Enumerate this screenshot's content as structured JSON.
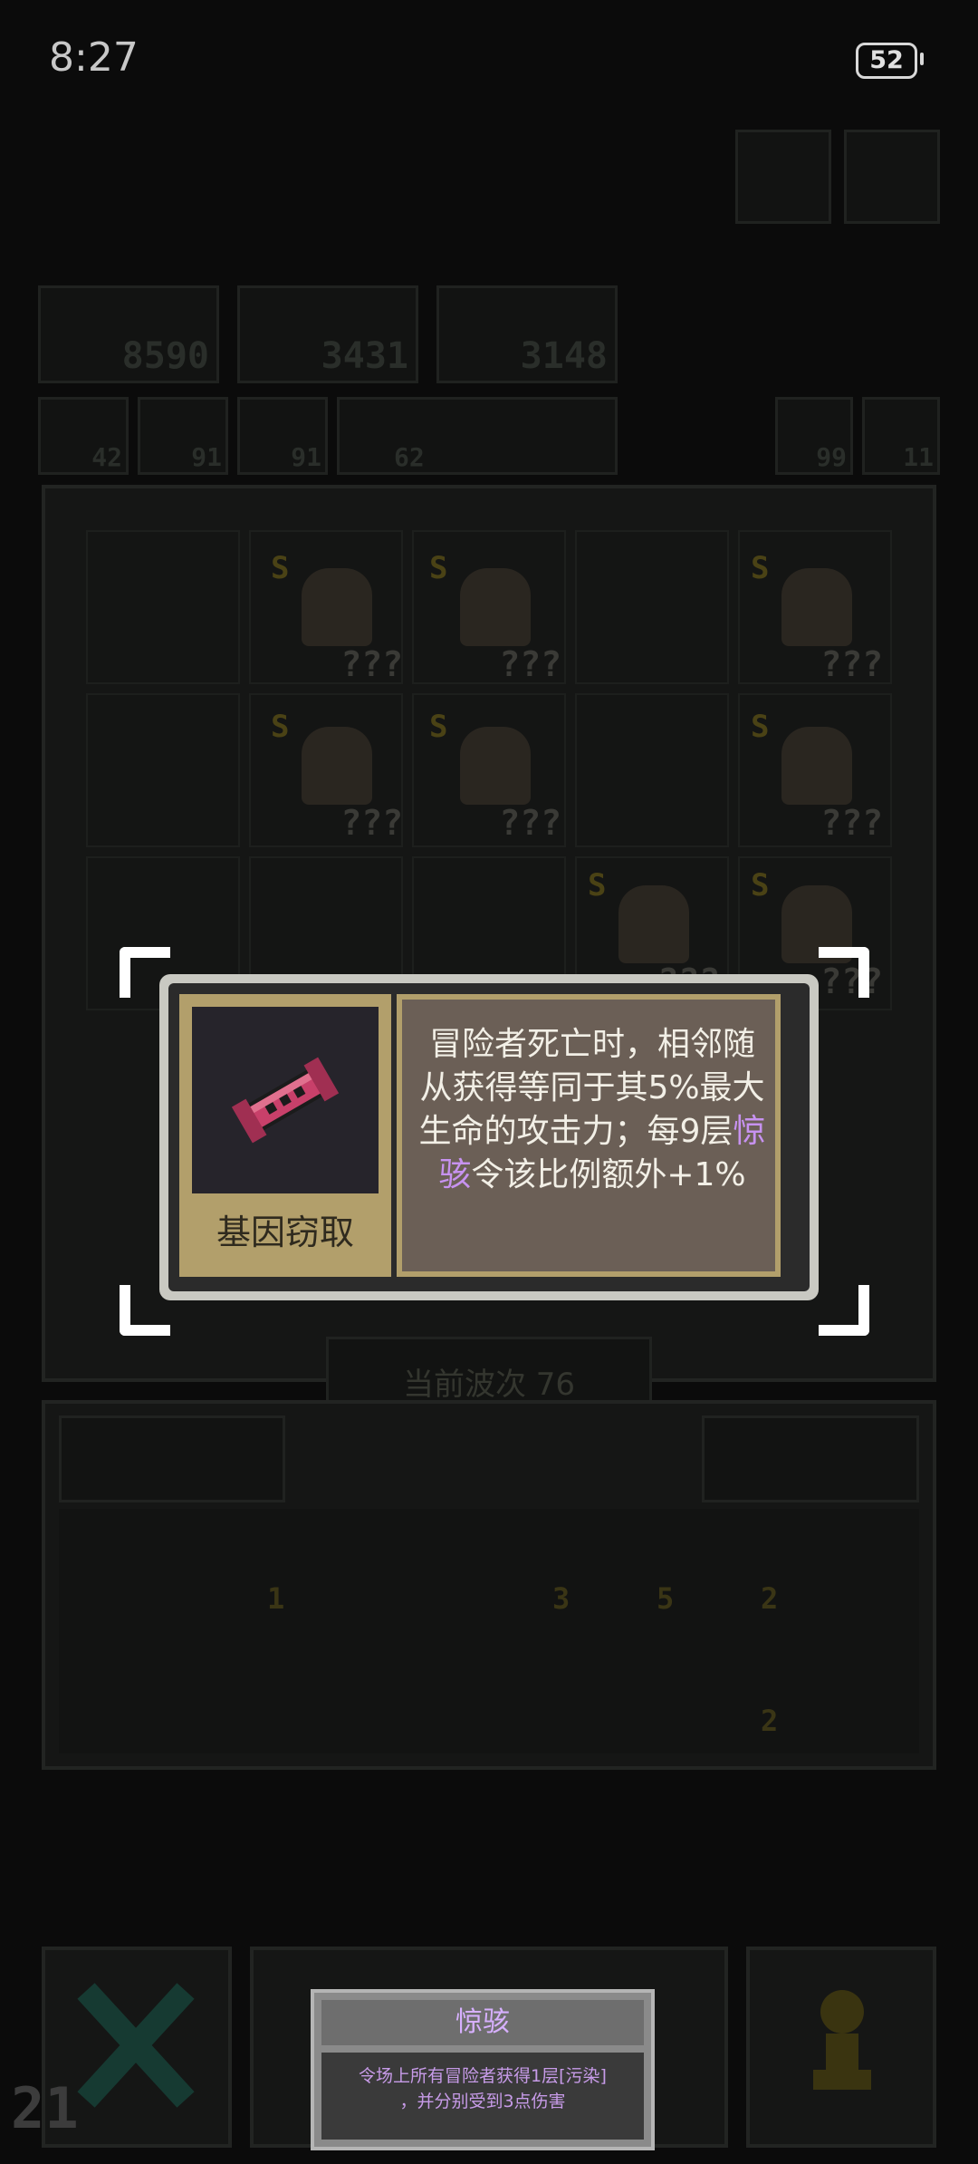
{
  "status_bar": {
    "time": "8:27",
    "battery": "52"
  },
  "resources": {
    "counters": [
      "8590",
      "3431",
      "3148"
    ],
    "small_counters": [
      "42",
      "91",
      "91",
      "62"
    ],
    "right_counters": [
      "99",
      "11"
    ]
  },
  "board": {
    "hero_labels": [
      "???",
      "???",
      "???",
      "???",
      "???",
      "???",
      "???",
      "???",
      "???",
      "???"
    ],
    "rank": "S"
  },
  "wave": {
    "label": "当前波次 76"
  },
  "inventory": {
    "counts": [
      "1",
      "3",
      "5",
      "2",
      "2"
    ]
  },
  "tooltip": {
    "item_name": "基因窃取",
    "desc_before": "冒险者死亡时，相邻随从获得等同于其5%最大生命的攻击力；每9层",
    "keyword": "惊骇",
    "desc_after": "令该比例额外+1%"
  },
  "toast": {
    "title": "惊骇",
    "line1": "令场上所有冒险者获得1层[污染]",
    "line2": "，并分别受到3点伤害"
  },
  "corner_number": "21",
  "colors": {
    "keyword": "#c792f0",
    "card_gold": "#b29f6b",
    "desc_bg": "#6b5f56"
  }
}
